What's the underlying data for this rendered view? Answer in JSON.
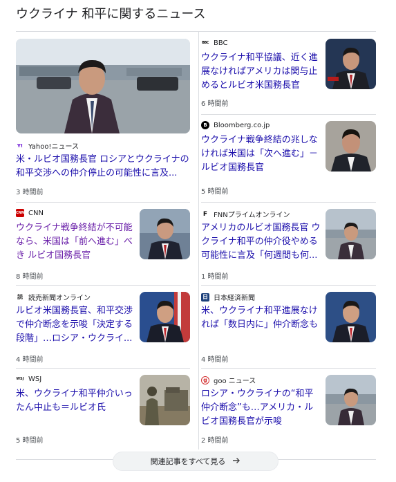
{
  "heading": "ウクライナ 和平に関するニュース",
  "colors": {
    "link": "#1a0dab",
    "visited": "#681da8",
    "divider": "#dadce0"
  },
  "articles": [
    {
      "source": "Yahoo!ニュース",
      "logo": "Y!",
      "title": "米・ルビオ国務長官 ロシアとウクライナの和平交渉への仲介停止の可能性に言及...",
      "time": "3 時間前"
    },
    {
      "source": "BBC",
      "logo": "BBC",
      "title": "ウクライナ和平協議、近く進展なければアメリカは関与止めるとルビオ米国務長官",
      "time": "6 時間前"
    },
    {
      "source": "Bloomberg.co.jp",
      "logo": "B",
      "title": "ウクライナ戦争終結の兆しなければ米国は「次へ進む」－ルビオ国務長官",
      "time": "5 時間前"
    },
    {
      "source": "CNN",
      "logo": "CNN",
      "title": "ウクライナ戦争終結が不可能なら、米国は「前へ進む」べき ルビオ国務長官",
      "time": "8 時間前"
    },
    {
      "source": "FNNプライムオンライン",
      "logo": "F",
      "title": "アメリカのルビオ国務長官 ウクライナ和平の仲介役やめる可能性に言及「何週間も何...",
      "time": "1 時間前"
    },
    {
      "source": "読売新聞オンライン",
      "logo": "読",
      "title": "ルビオ米国務長官、和平交渉で仲介断念を示唆「決定する段階」…ロシア・ウクライ...",
      "time": "4 時間前"
    },
    {
      "source": "日本経済新聞",
      "logo": "日",
      "title": "米、ウクライナ和平進展なければ「数日内に」仲介断念も",
      "time": "4 時間前"
    },
    {
      "source": "WSJ",
      "logo": "WSJ",
      "title": "米、ウクライナ和平仲介いったん中止も＝ルビオ氏",
      "time": "5 時間前"
    },
    {
      "source": "goo ニュース",
      "logo": "g",
      "title": "ロシア・ウクライナの“和平仲介断念”も…アメリカ・ルビオ国務長官が示唆",
      "time": "2 時間前"
    }
  ],
  "more_button": {
    "label": "関連記事をすべて見る",
    "icon": "arrow-right-icon"
  }
}
